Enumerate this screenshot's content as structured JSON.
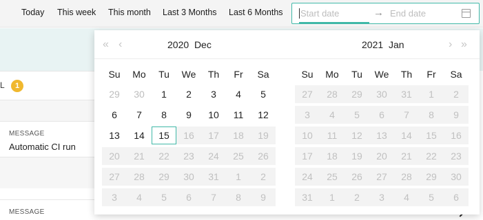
{
  "toolbar": {
    "presets": [
      "Today",
      "This week",
      "This month",
      "Last 3 Months",
      "Last 6 Months"
    ],
    "range": {
      "start_placeholder": "Start date",
      "separator": "→",
      "end_placeholder": "End date",
      "icon": "calendar-icon"
    }
  },
  "background": {
    "filter_label": "L",
    "count_badge": "1",
    "items": [
      {
        "caption": "MESSAGE",
        "value": "Automatic CI run"
      },
      {
        "caption": "MESSAGE",
        "value": ""
      }
    ]
  },
  "calendar": {
    "accent_color": "#3fb8a7",
    "weekdays": [
      "Su",
      "Mo",
      "Tu",
      "We",
      "Th",
      "Fr",
      "Sa"
    ],
    "left": {
      "year": "2020",
      "month": "Dec",
      "nav": [
        "«",
        "‹"
      ],
      "weeks": [
        [
          [
            "29",
            "out"
          ],
          [
            "30",
            "out"
          ],
          [
            "1",
            "in"
          ],
          [
            "2",
            "in"
          ],
          [
            "3",
            "in"
          ],
          [
            "4",
            "in"
          ],
          [
            "5",
            "in"
          ]
        ],
        [
          [
            "6",
            "in"
          ],
          [
            "7",
            "in"
          ],
          [
            "8",
            "in"
          ],
          [
            "9",
            "in"
          ],
          [
            "10",
            "in"
          ],
          [
            "11",
            "in"
          ],
          [
            "12",
            "in"
          ]
        ],
        [
          [
            "13",
            "in"
          ],
          [
            "14",
            "in"
          ],
          [
            "15",
            "today"
          ],
          [
            "16",
            "dis"
          ],
          [
            "17",
            "dis"
          ],
          [
            "18",
            "dis"
          ],
          [
            "19",
            "dis"
          ]
        ],
        [
          [
            "20",
            "dis"
          ],
          [
            "21",
            "dis"
          ],
          [
            "22",
            "dis"
          ],
          [
            "23",
            "dis"
          ],
          [
            "24",
            "dis"
          ],
          [
            "25",
            "dis"
          ],
          [
            "26",
            "dis"
          ]
        ],
        [
          [
            "27",
            "dis"
          ],
          [
            "28",
            "dis"
          ],
          [
            "29",
            "dis"
          ],
          [
            "30",
            "dis"
          ],
          [
            "31",
            "dis"
          ],
          [
            "1",
            "dis"
          ],
          [
            "2",
            "dis"
          ]
        ],
        [
          [
            "3",
            "dis"
          ],
          [
            "4",
            "dis"
          ],
          [
            "5",
            "dis"
          ],
          [
            "6",
            "dis"
          ],
          [
            "7",
            "dis"
          ],
          [
            "8",
            "dis"
          ],
          [
            "9",
            "dis"
          ]
        ]
      ]
    },
    "right": {
      "year": "2021",
      "month": "Jan",
      "nav": [
        "›",
        "»"
      ],
      "weeks": [
        [
          [
            "27",
            "dis"
          ],
          [
            "28",
            "dis"
          ],
          [
            "29",
            "dis"
          ],
          [
            "30",
            "dis"
          ],
          [
            "31",
            "dis"
          ],
          [
            "1",
            "dis"
          ],
          [
            "2",
            "dis"
          ]
        ],
        [
          [
            "3",
            "dis"
          ],
          [
            "4",
            "dis"
          ],
          [
            "5",
            "dis"
          ],
          [
            "6",
            "dis"
          ],
          [
            "7",
            "dis"
          ],
          [
            "8",
            "dis"
          ],
          [
            "9",
            "dis"
          ]
        ],
        [
          [
            "10",
            "dis"
          ],
          [
            "11",
            "dis"
          ],
          [
            "12",
            "dis"
          ],
          [
            "13",
            "dis"
          ],
          [
            "14",
            "dis"
          ],
          [
            "15",
            "dis"
          ],
          [
            "16",
            "dis"
          ]
        ],
        [
          [
            "17",
            "dis"
          ],
          [
            "18",
            "dis"
          ],
          [
            "19",
            "dis"
          ],
          [
            "20",
            "dis"
          ],
          [
            "21",
            "dis"
          ],
          [
            "22",
            "dis"
          ],
          [
            "23",
            "dis"
          ]
        ],
        [
          [
            "24",
            "dis"
          ],
          [
            "25",
            "dis"
          ],
          [
            "26",
            "dis"
          ],
          [
            "27",
            "dis"
          ],
          [
            "28",
            "dis"
          ],
          [
            "29",
            "dis"
          ],
          [
            "30",
            "dis"
          ]
        ],
        [
          [
            "31",
            "dis"
          ],
          [
            "1",
            "dis"
          ],
          [
            "2",
            "dis"
          ],
          [
            "3",
            "dis"
          ],
          [
            "4",
            "dis"
          ],
          [
            "5",
            "dis"
          ],
          [
            "6",
            "dis"
          ]
        ]
      ]
    }
  }
}
